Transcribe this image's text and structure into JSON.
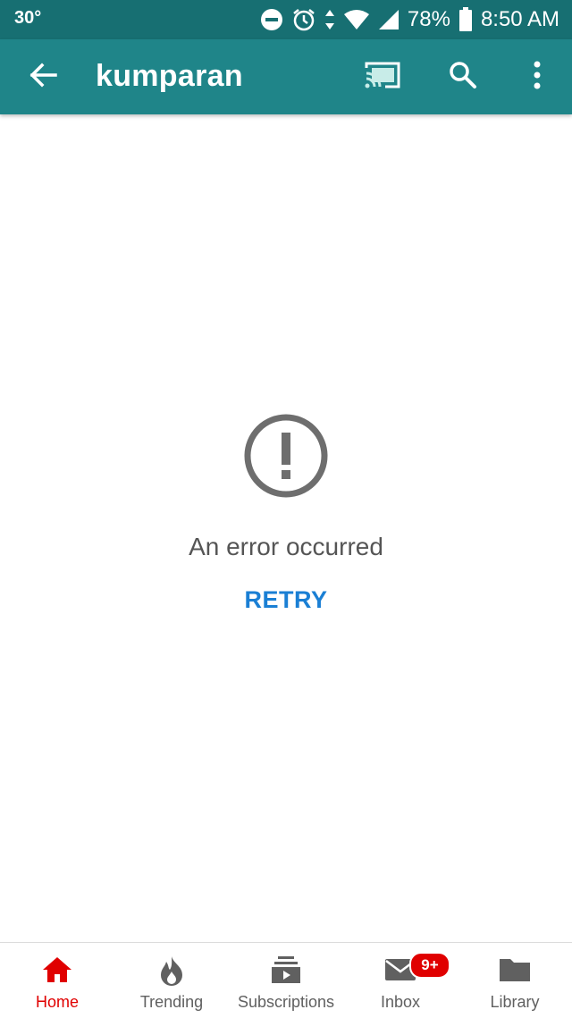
{
  "status_bar": {
    "temperature": "30°",
    "battery": "78%",
    "time": "8:50 AM",
    "icons": [
      "do-not-disturb-icon",
      "alarm-icon",
      "data-arrows-icon",
      "wifi-icon",
      "signal-icon",
      "battery-icon"
    ]
  },
  "app_bar": {
    "title": "kumparan",
    "icons": [
      "back-arrow-icon",
      "cast-icon",
      "search-icon",
      "more-vert-icon"
    ]
  },
  "error": {
    "icon": "error-circle-icon",
    "message": "An error occurred",
    "retry_label": "RETRY"
  },
  "bottom_nav": {
    "items": [
      {
        "label": "Home",
        "icon": "home-icon",
        "active": true
      },
      {
        "label": "Trending",
        "icon": "flame-icon"
      },
      {
        "label": "Subscriptions",
        "icon": "subscriptions-icon"
      },
      {
        "label": "Inbox",
        "icon": "mail-icon",
        "badge": "9+"
      },
      {
        "label": "Library",
        "icon": "folder-icon"
      }
    ]
  },
  "colors": {
    "status_bar": "#176f72",
    "app_bar": "#1f8589",
    "accent_active": "#e00000",
    "retry": "#1a7fd4"
  }
}
